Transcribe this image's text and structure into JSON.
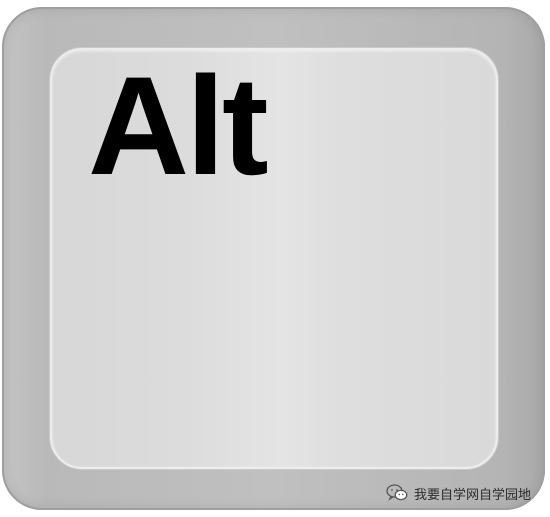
{
  "key": {
    "label": "Alt"
  },
  "watermark": {
    "text": "我要自学网自学园地",
    "icon": "wechat-icon"
  },
  "colors": {
    "keycap_outer": "#bdbdbd",
    "key_face": "#dcdcdc",
    "label": "#000000"
  }
}
